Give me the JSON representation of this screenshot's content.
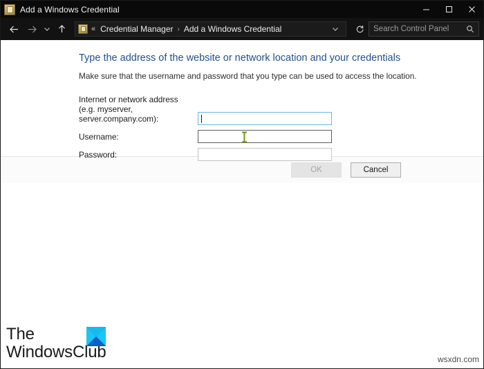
{
  "window": {
    "title": "Add a Windows Credential",
    "title_icon": "credential-icon",
    "controls": {
      "minimize": "minimize-icon",
      "maximize": "maximize-icon",
      "close": "close-icon"
    }
  },
  "navbar": {
    "back": "back-arrow-icon",
    "forward": "forward-arrow-icon",
    "recent": "chevron-down-icon",
    "up": "up-arrow-icon",
    "breadcrumb": {
      "icon": "credential-icon",
      "overflow": "«",
      "items": [
        "Credential Manager",
        "Add a Windows Credential"
      ],
      "separator": "›"
    },
    "dropdown": "chevron-down-icon",
    "refresh": "refresh-icon",
    "search": {
      "placeholder": "Search Control Panel",
      "value": "",
      "icon": "search-icon"
    }
  },
  "form": {
    "heading": "Type the address of the website or network location and your credentials",
    "subheading": "Make sure that the username and password that you type can be used to access the location.",
    "fields": [
      {
        "label_line1": "Internet or network address",
        "label_line2": "(e.g. myserver, server.company.com):",
        "value": "",
        "state": "focused",
        "type": "text"
      },
      {
        "label_line1": "Username:",
        "label_line2": "",
        "value": "",
        "state": "hovered",
        "type": "text"
      },
      {
        "label_line1": "Password:",
        "label_line2": "",
        "value": "",
        "state": "idle",
        "type": "password"
      }
    ]
  },
  "buttons": {
    "ok": "OK",
    "ok_enabled": false,
    "cancel": "Cancel",
    "cancel_enabled": true
  },
  "branding": {
    "logo_line1": "The",
    "logo_line2": "WindowsClub",
    "logo_mark": "windowsclub-logo-icon",
    "watermark": "wsxdn.com"
  },
  "colors": {
    "titlebar_bg": "#0a0a0a",
    "navbar_bg": "#121212",
    "heading_blue": "#1f4f8f",
    "focus_border": "#6bb4e8",
    "logo_cyan": "#19c6f5",
    "logo_blue": "#0b63cf"
  }
}
